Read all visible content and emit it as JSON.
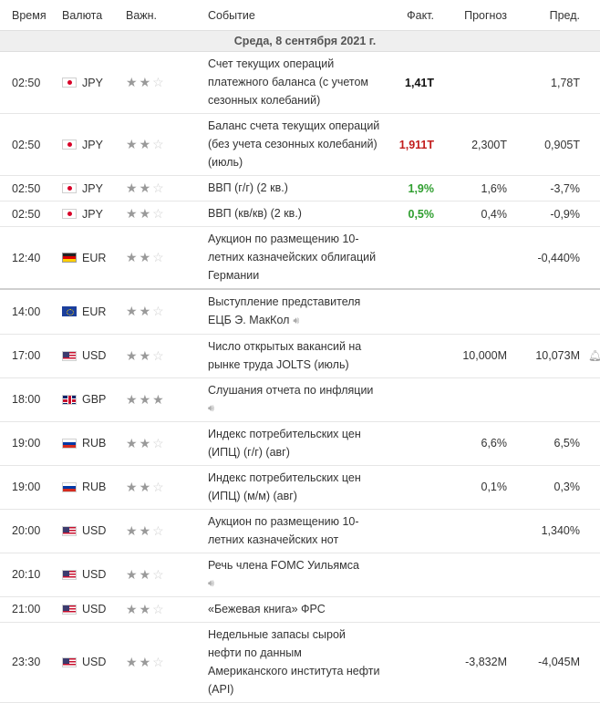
{
  "headers": {
    "time": "Время",
    "currency": "Валюта",
    "importance": "Важн.",
    "event": "Событие",
    "actual": "Факт.",
    "forecast": "Прогноз",
    "previous": "Пред."
  },
  "date_label": "Среда, 8 сентября 2021 г.",
  "colors": {
    "actual_positive": "#2e9e2e",
    "actual_negative": "#c21c1c",
    "star_active": "#9a9a9a",
    "star_inactive": "#cfcfcf",
    "date_row_bg": "#efefef"
  },
  "rows": [
    {
      "time": "02:50",
      "currency": "JPY",
      "flag": "jp",
      "importance": 2,
      "event": "Счет текущих операций платежного баланса (с учетом сезонных колебаний)",
      "actual": "1,41T",
      "actual_style": "bold",
      "forecast": "",
      "previous": "1,78T"
    },
    {
      "time": "02:50",
      "currency": "JPY",
      "flag": "jp",
      "importance": 2,
      "event": "Баланс счета текущих операций (без учета сезонных колебаний) (июль)",
      "actual": "1,911T",
      "actual_style": "red",
      "forecast": "2,300T",
      "previous": "0,905T"
    },
    {
      "time": "02:50",
      "currency": "JPY",
      "flag": "jp",
      "importance": 2,
      "event": "ВВП (г/г) (2 кв.)",
      "actual": "1,9%",
      "actual_style": "green",
      "forecast": "1,6%",
      "previous": "-3,7%"
    },
    {
      "time": "02:50",
      "currency": "JPY",
      "flag": "jp",
      "importance": 2,
      "event": "ВВП (кв/кв) (2 кв.)",
      "actual": "0,5%",
      "actual_style": "green",
      "forecast": "0,4%",
      "previous": "-0,9%"
    },
    {
      "time": "12:40",
      "currency": "EUR",
      "flag": "de",
      "importance": 2,
      "event": "Аукцион по размещению 10-летних казначейских облигаций Германии",
      "actual": "",
      "actual_style": "",
      "forecast": "",
      "previous": "-0,440%",
      "divider": true
    },
    {
      "time": "14:00",
      "currency": "EUR",
      "flag": "eu",
      "importance": 2,
      "event": "Выступление представителя ЕЦБ Э. МакКол",
      "speech": "inline",
      "actual": "",
      "actual_style": "",
      "forecast": "",
      "previous": ""
    },
    {
      "time": "17:00",
      "currency": "USD",
      "flag": "us",
      "importance": 2,
      "event": "Число открытых вакансий на рынке труда JOLTS (июль)",
      "actual": "",
      "actual_style": "",
      "forecast": "10,000M",
      "previous": "10,073M",
      "alert": true
    },
    {
      "time": "18:00",
      "currency": "GBP",
      "flag": "gb",
      "importance": 3,
      "event": "Слушания отчета по инфляции",
      "speech": "block",
      "actual": "",
      "actual_style": "",
      "forecast": "",
      "previous": ""
    },
    {
      "time": "19:00",
      "currency": "RUB",
      "flag": "ru",
      "importance": 2,
      "event": "Индекс потребительских цен (ИПЦ) (г/г) (авг)",
      "actual": "",
      "actual_style": "",
      "forecast": "6,6%",
      "previous": "6,5%"
    },
    {
      "time": "19:00",
      "currency": "RUB",
      "flag": "ru",
      "importance": 2,
      "event": "Индекс потребительских цен (ИПЦ) (м/м) (авг)",
      "actual": "",
      "actual_style": "",
      "forecast": "0,1%",
      "previous": "0,3%"
    },
    {
      "time": "20:00",
      "currency": "USD",
      "flag": "us",
      "importance": 2,
      "event": "Аукцион по размещению 10-летних казначейских нот",
      "actual": "",
      "actual_style": "",
      "forecast": "",
      "previous": "1,340%"
    },
    {
      "time": "20:10",
      "currency": "USD",
      "flag": "us",
      "importance": 2,
      "event": "Речь члена FOMC Уильямса",
      "speech": "block",
      "actual": "",
      "actual_style": "",
      "forecast": "",
      "previous": ""
    },
    {
      "time": "21:00",
      "currency": "USD",
      "flag": "us",
      "importance": 2,
      "event": "«Бежевая книга» ФРС",
      "actual": "",
      "actual_style": "",
      "forecast": "",
      "previous": ""
    },
    {
      "time": "23:30",
      "currency": "USD",
      "flag": "us",
      "importance": 2,
      "event": "Недельные запасы сырой нефти по данным Американского института нефти (API)",
      "actual": "",
      "actual_style": "",
      "forecast": "-3,832M",
      "previous": "-4,045M"
    }
  ]
}
